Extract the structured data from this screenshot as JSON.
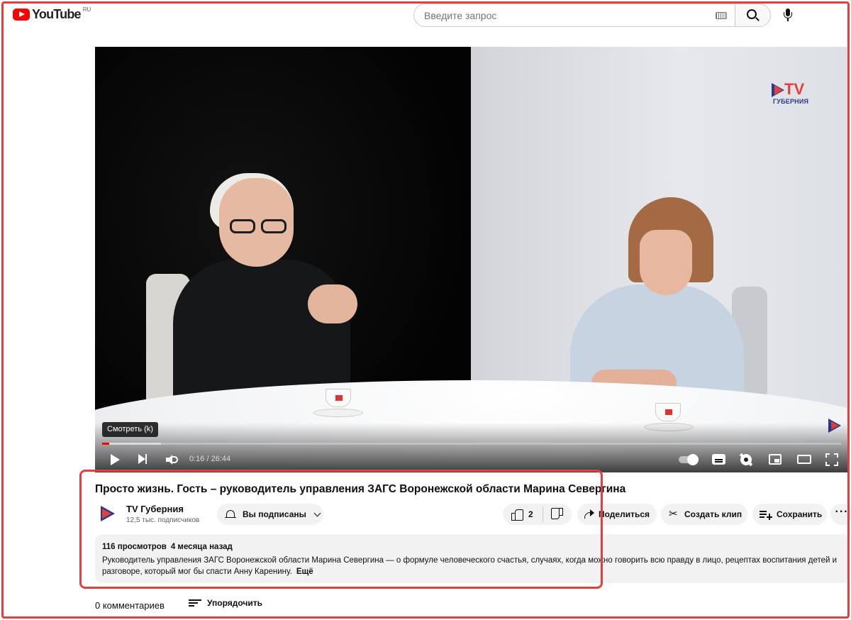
{
  "header": {
    "logo_text": "YouTube",
    "region": "RU",
    "search_placeholder": "Введите запрос"
  },
  "player": {
    "tooltip": "Смотреть (k)",
    "time_display": "0:16 / 26:44",
    "progress_percent": 1,
    "buffer_percent": 8,
    "overlay_logo": "TV",
    "overlay_logo_sub": "ГУБЕРНИЯ"
  },
  "video": {
    "title": "Просто жизнь. Гость – руководитель управления ЗАГС Воронежской области Марина Севергина"
  },
  "channel": {
    "name": "TV Губерния",
    "subscribers": "12,5 тыс. подписчиков",
    "subscribe_label": "Вы подписаны"
  },
  "actions": {
    "like_count": "2",
    "share_label": "Поделиться",
    "clip_label": "Создать клип",
    "save_label": "Сохранить",
    "more_label": "···"
  },
  "description": {
    "views": "116 просмотров",
    "date": "4 месяца назад",
    "text": "Руководитель управления ЗАГС Воронежской области Марина Севергина — о формуле человеческого счастья, случаях, когда можно говорить всю правду в лицо, рецептах воспитания детей и разговоре, который мог бы спасти Анну Каренину.",
    "more_label": "Ещё"
  },
  "comments": {
    "count_label": "0 комментариев",
    "sort_label": "Упорядочить"
  },
  "colors": {
    "brand_red": "#ff0000",
    "highlight": "#e0403f",
    "channel_blue": "#2a3a8a"
  }
}
